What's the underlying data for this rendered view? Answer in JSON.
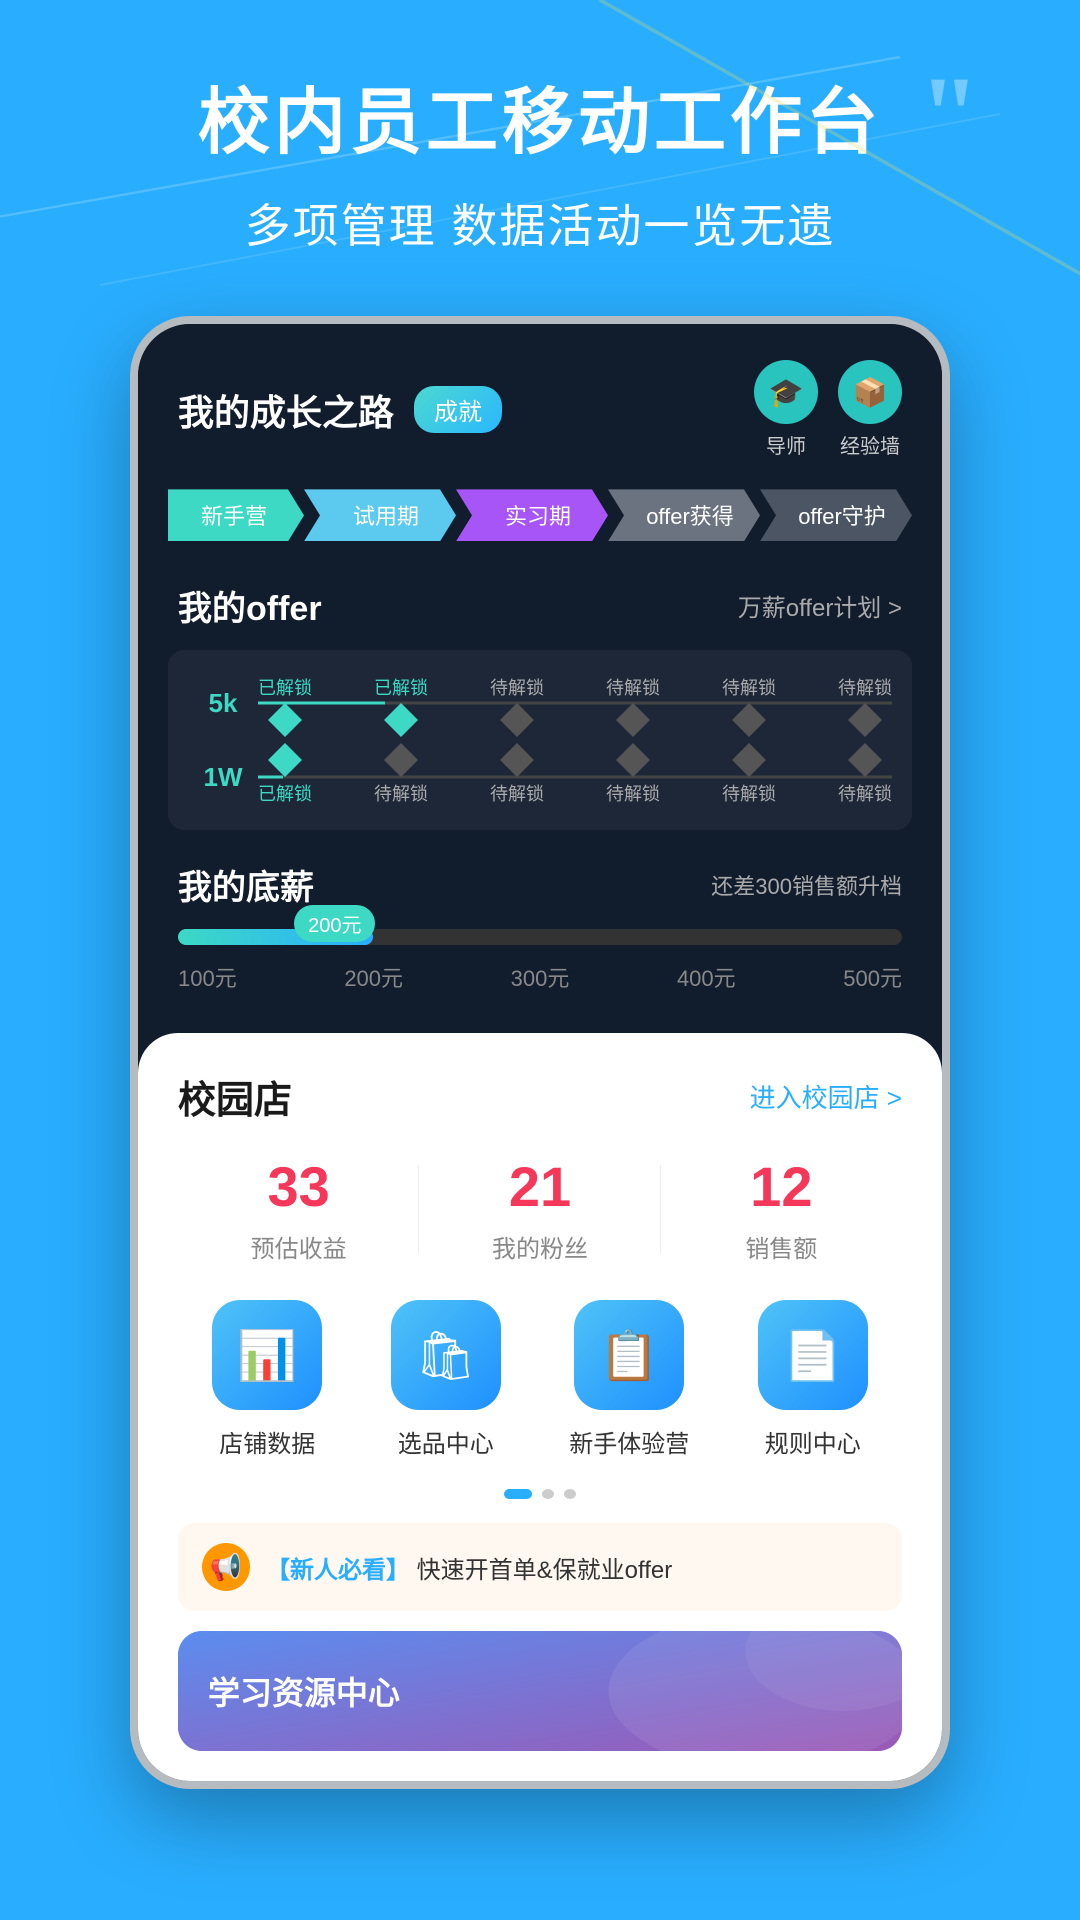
{
  "hero": {
    "title": "校内员工移动工作台",
    "subtitle": "多项管理  数据活动一览无遗",
    "quote_mark": "””"
  },
  "phone": {
    "header": {
      "title": "我的成长之路",
      "badge": "成就",
      "icons": [
        {
          "label": "导师",
          "symbol": "🎓"
        },
        {
          "label": "经验墙",
          "symbol": "📦"
        }
      ]
    },
    "steps": [
      {
        "label": "新手营",
        "class": "step-xinshoucamping"
      },
      {
        "label": "试用期",
        "class": "step-shiyongqi"
      },
      {
        "label": "实习期",
        "class": "step-shixiqi"
      },
      {
        "label": "offer获得",
        "class": "step-offerhuo"
      },
      {
        "label": "offer守护",
        "class": "step-offershou"
      }
    ],
    "offer_section": {
      "title": "我的offer",
      "link": "万薪offer计划 >",
      "rows": [
        {
          "salary": "5k",
          "nodes": [
            {
              "label": "已解锁",
              "active": true
            },
            {
              "label": "已解锁",
              "active": true
            },
            {
              "label": "待解锁",
              "active": false
            },
            {
              "label": "待解锁",
              "active": false
            },
            {
              "label": "待解锁",
              "active": false
            },
            {
              "label": "待解锁",
              "active": false
            }
          ]
        },
        {
          "salary": "1W",
          "nodes": [
            {
              "label": "已解锁",
              "active": true
            },
            {
              "label": "待解锁",
              "active": false
            },
            {
              "label": "待解锁",
              "active": false
            },
            {
              "label": "待解锁",
              "active": false
            },
            {
              "label": "待解锁",
              "active": false
            },
            {
              "label": "待解锁",
              "active": false
            }
          ]
        }
      ]
    },
    "base_salary": {
      "title": "我的底薪",
      "hint": "还差300销售额升档",
      "current": "200元",
      "fill_percent": 27,
      "scale": [
        "100元",
        "200元",
        "300元",
        "400元",
        "500元"
      ]
    },
    "campus_store": {
      "title": "校园店",
      "link": "进入校园店 >",
      "stats": [
        {
          "value": "33",
          "label": "预估收益"
        },
        {
          "value": "21",
          "label": "我的粉丝"
        },
        {
          "value": "12",
          "label": "销售额"
        }
      ],
      "actions": [
        {
          "label": "店铺数据",
          "icon": "📊"
        },
        {
          "label": "选品中心",
          "icon": "🛍"
        },
        {
          "label": "新手体验营",
          "icon": "📋"
        },
        {
          "label": "规则中心",
          "icon": "📄"
        }
      ]
    },
    "notice": {
      "icon": "📢",
      "prefix": "【新人必看】",
      "text": "快速开首单&保就业offer"
    }
  }
}
